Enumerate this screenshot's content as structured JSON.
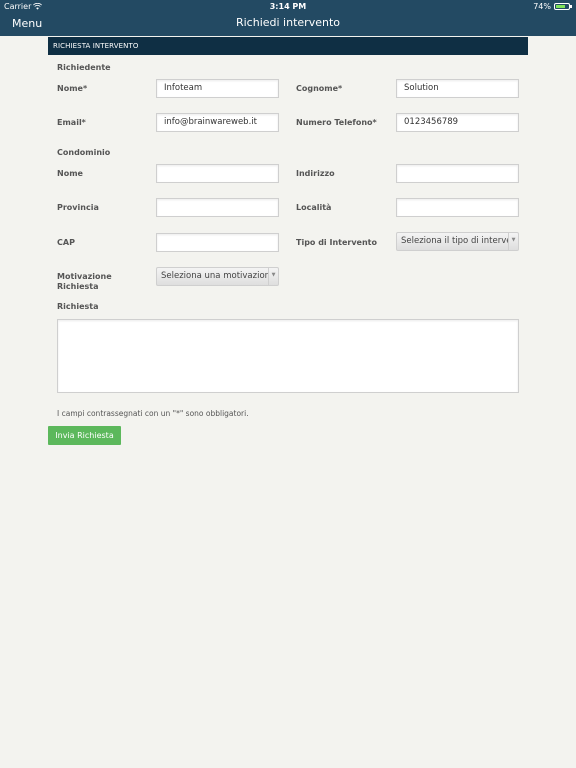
{
  "status": {
    "carrier": "Carrier",
    "time": "3:14 PM",
    "battery": "74%"
  },
  "nav": {
    "menu_label": "Menu",
    "title": "Richiedi intervento"
  },
  "form": {
    "section_title": "RICHIESTA INTERVENTO",
    "richiedente_label": "Richiedente",
    "condominio_label": "Condominio",
    "nome_label": "Nome*",
    "nome_value": "Infoteam",
    "cognome_label": "Cognome*",
    "cognome_value": "Solution",
    "email_label": "Email*",
    "email_value": "info@brainwareweb.it",
    "telefono_label": "Numero Telefono*",
    "telefono_value": "0123456789",
    "cond_nome_label": "Nome",
    "cond_nome_value": "",
    "indirizzo_label": "Indirizzo",
    "indirizzo_value": "",
    "provincia_label": "Provincia",
    "provincia_value": "",
    "localita_label": "Località",
    "localita_value": "",
    "cap_label": "CAP",
    "cap_value": "",
    "tipo_label": "Tipo di Intervento",
    "tipo_selected": "Seleziona il tipo di intervento",
    "motivazione_label_line1": "Motivazione",
    "motivazione_label_line2": "Richiesta",
    "motivazione_selected": "Seleziona una motivazione",
    "richiesta_label": "Richiesta",
    "richiesta_value": "",
    "required_note": "I campi contrassegnati con un \"*\" sono obbligatori.",
    "submit_label": "Invia Richiesta"
  }
}
